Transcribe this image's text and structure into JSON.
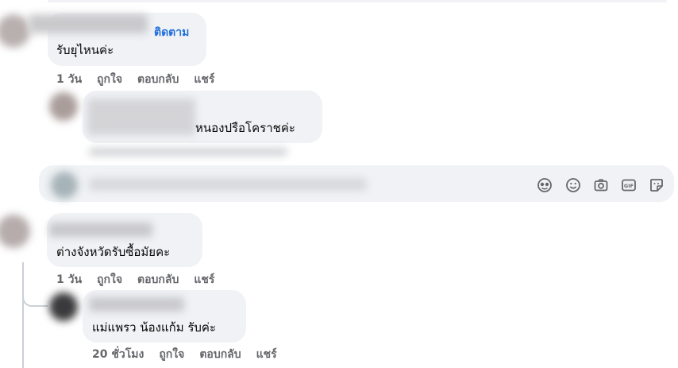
{
  "comment1": {
    "follow_label": "ติดตาม",
    "text": "รับยุไหนค่ะ",
    "time": "1 วัน",
    "like": "ถูกใจ",
    "reply": "ตอบกลับ",
    "share": "แชร์"
  },
  "comment2": {
    "text": "หนองปรือโคราชค่ะ"
  },
  "composer": {
    "placeholder": "",
    "icons": [
      "avatar-sticker-icon",
      "emoji-icon",
      "camera-icon",
      "gif-icon",
      "sticker-icon"
    ]
  },
  "comment3": {
    "text": "ต่างจังหวัดรับซื้อมัยคะ",
    "time": "1 วัน",
    "like": "ถูกใจ",
    "reply": "ตอบกลับ",
    "share": "แชร์"
  },
  "comment4": {
    "text": "แม่แพรว น้องแก้ม รับค่ะ",
    "time": "20 ชั่วโมง",
    "like": "ถูกใจ",
    "reply": "ตอบกลับ",
    "share": "แชร์"
  },
  "colors": {
    "bubble": "#f0f2f5",
    "meta_text": "#65676b",
    "link": "#216fdb"
  }
}
